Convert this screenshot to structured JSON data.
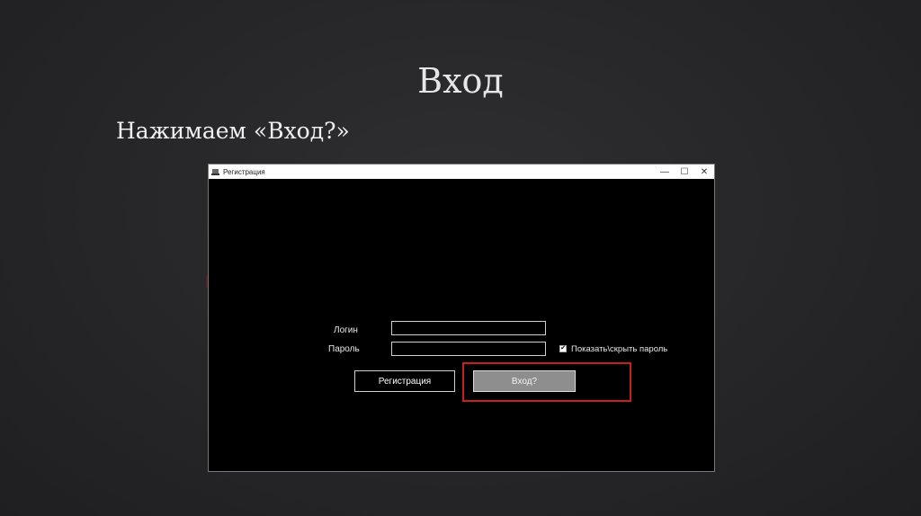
{
  "slide": {
    "title": "Вход",
    "subtitle": "Нажимаем «Вход?»"
  },
  "window": {
    "title": "Регистрация",
    "controls": {
      "minimize": "—",
      "maximize": "☐",
      "close": "✕"
    }
  },
  "form": {
    "login_label": "Логин",
    "login_value": "",
    "password_label": "Пароль",
    "password_value": "",
    "show_password_label": "Показать\\скрыть пароль",
    "show_password_checked": true,
    "register_button": "Регистрация",
    "login_button": "Вход?"
  },
  "colors": {
    "highlight": "#c81e1e",
    "background": "#262628",
    "window_background": "#000000"
  }
}
